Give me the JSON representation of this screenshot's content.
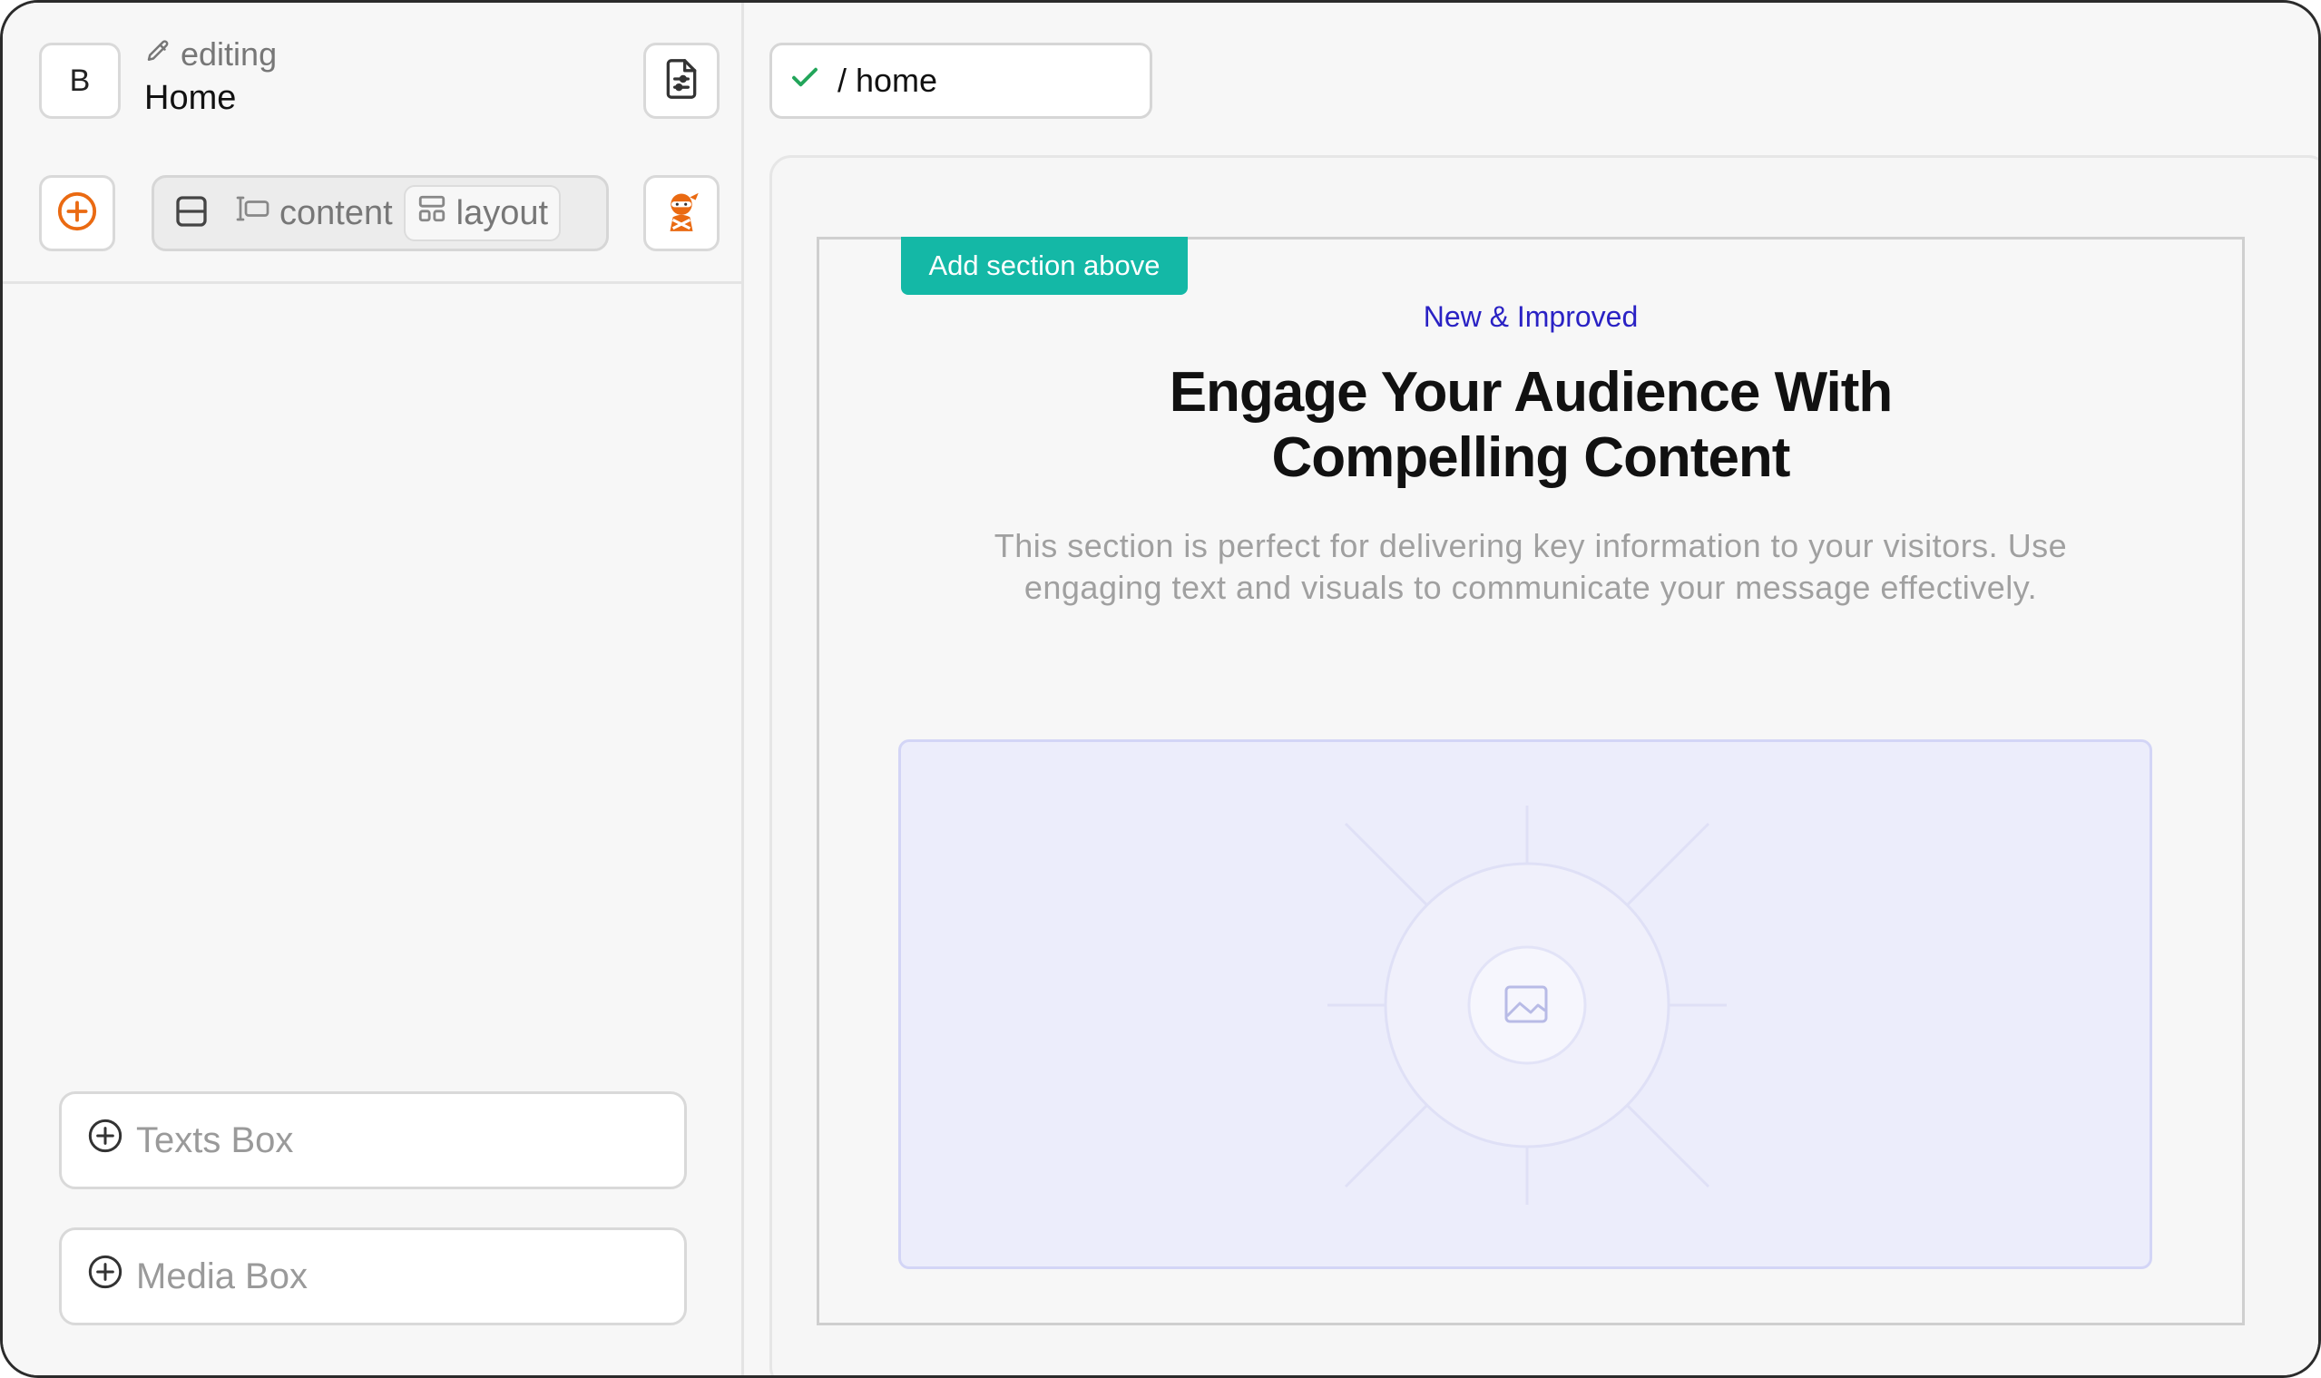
{
  "sidebar": {
    "logo_letter": "B",
    "status_label": "editing",
    "page_name": "Home",
    "modes": {
      "content_label": "content",
      "layout_label": "layout",
      "active": "layout"
    },
    "add_boxes": [
      {
        "label": "Texts Box"
      },
      {
        "label": "Media Box"
      }
    ]
  },
  "main": {
    "route": "/ home",
    "section": {
      "add_above_label": "Add section above",
      "eyebrow": "New & Improved",
      "headline": "Engage Your Audience With Compelling Content",
      "body": "This section is perfect for delivering key information to your visitors. Use engaging text and visuals to communicate your message effectively."
    }
  },
  "colors": {
    "accent_orange": "#ea6a12",
    "teal": "#14b8a6",
    "eyebrow_blue": "#2a22c4",
    "check_green": "#22a55a",
    "media_bg": "#ecedfb"
  },
  "icons": [
    "pencil-icon",
    "document-settings-icon",
    "plus-circle-icon",
    "rows-icon",
    "text-cursor-icon",
    "layout-icon",
    "ninja-avatar-icon",
    "check-icon",
    "image-placeholder-icon"
  ]
}
